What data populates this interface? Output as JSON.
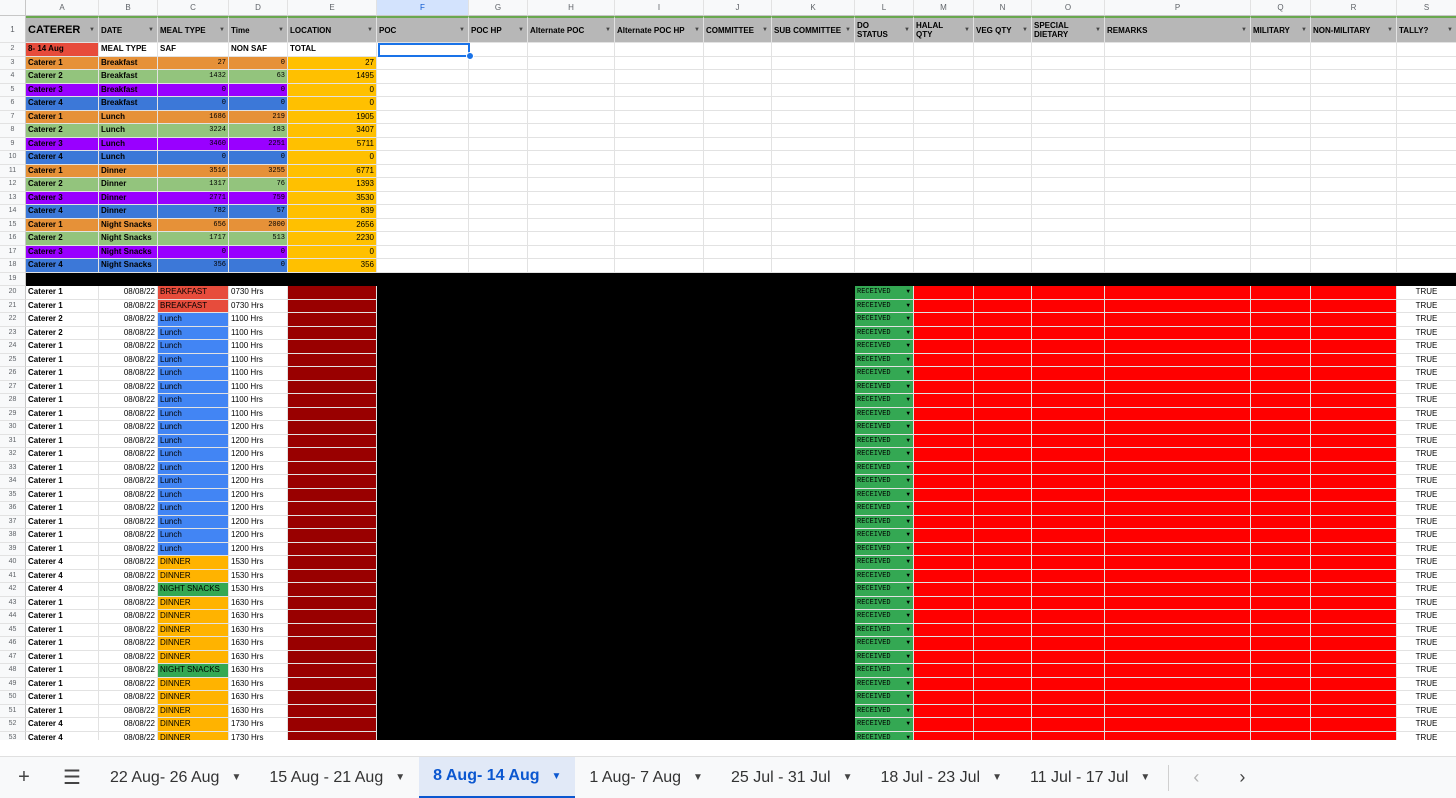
{
  "columns": [
    "A",
    "B",
    "C",
    "D",
    "E",
    "F",
    "G",
    "H",
    "I",
    "J",
    "K",
    "L",
    "M",
    "N",
    "O",
    "P",
    "Q",
    "R",
    "S"
  ],
  "header_row": [
    "CATERER",
    "DATE",
    "MEAL TYPE",
    "Time",
    "LOCATION",
    "POC",
    "POC HP",
    "Alternate POC",
    "Alternate POC HP",
    "COMMITTEE",
    "SUB COMMITTEE",
    "DO STATUS",
    "HALAL QTY",
    "VEG QTY",
    "SPECIAL DIETARY",
    "REMARKS",
    "MILITARY",
    "NON-MILITARY",
    "TALLY?"
  ],
  "summary_header": [
    "8- 14 Aug",
    "MEAL TYPE",
    "SAF",
    "NON SAF",
    "TOTAL"
  ],
  "summary_rows": [
    [
      "Caterer 1",
      "Breakfast",
      "27",
      "0",
      "27"
    ],
    [
      "Caterer 2",
      "Breakfast",
      "1432",
      "63",
      "1495"
    ],
    [
      "Caterer 3",
      "Breakfast",
      "0",
      "0",
      "0"
    ],
    [
      "Caterer 4",
      "Breakfast",
      "0",
      "0",
      "0"
    ],
    [
      "Caterer 1",
      "Lunch",
      "1686",
      "219",
      "1905"
    ],
    [
      "Caterer 2",
      "Lunch",
      "3224",
      "183",
      "3407"
    ],
    [
      "Caterer 3",
      "Lunch",
      "3460",
      "2251",
      "5711"
    ],
    [
      "Caterer 4",
      "Lunch",
      "0",
      "0",
      "0"
    ],
    [
      "Caterer 1",
      "Dinner",
      "3516",
      "3255",
      "6771"
    ],
    [
      "Caterer 2",
      "Dinner",
      "1317",
      "76",
      "1393"
    ],
    [
      "Caterer 3",
      "Dinner",
      "2771",
      "759",
      "3530"
    ],
    [
      "Caterer 4",
      "Dinner",
      "782",
      "57",
      "839"
    ],
    [
      "Caterer 1",
      "Night Snacks",
      "656",
      "2000",
      "2656"
    ],
    [
      "Caterer 2",
      "Night Snacks",
      "1717",
      "513",
      "2230"
    ],
    [
      "Caterer 3",
      "Night Snacks",
      "0",
      "0",
      "0"
    ],
    [
      "Caterer 4",
      "Night Snacks",
      "356",
      "0",
      "356"
    ]
  ],
  "detail_rows": [
    [
      "Caterer 1",
      "08/08/22",
      "BREAKFAST",
      "0730 Hrs",
      "RECEIVED",
      "TRUE"
    ],
    [
      "Caterer 1",
      "08/08/22",
      "BREAKFAST",
      "0730 Hrs",
      "RECEIVED",
      "TRUE"
    ],
    [
      "Caterer 2",
      "08/08/22",
      "Lunch",
      "1100 Hrs",
      "RECEIVED",
      "TRUE"
    ],
    [
      "Caterer 2",
      "08/08/22",
      "Lunch",
      "1100 Hrs",
      "RECEIVED",
      "TRUE"
    ],
    [
      "Caterer 1",
      "08/08/22",
      "Lunch",
      "1100 Hrs",
      "RECEIVED",
      "TRUE"
    ],
    [
      "Caterer 1",
      "08/08/22",
      "Lunch",
      "1100 Hrs",
      "RECEIVED",
      "TRUE"
    ],
    [
      "Caterer 1",
      "08/08/22",
      "Lunch",
      "1100 Hrs",
      "RECEIVED",
      "TRUE"
    ],
    [
      "Caterer 1",
      "08/08/22",
      "Lunch",
      "1100 Hrs",
      "RECEIVED",
      "TRUE"
    ],
    [
      "Caterer 1",
      "08/08/22",
      "Lunch",
      "1100 Hrs",
      "RECEIVED",
      "TRUE"
    ],
    [
      "Caterer 1",
      "08/08/22",
      "Lunch",
      "1100 Hrs",
      "RECEIVED",
      "TRUE"
    ],
    [
      "Caterer 1",
      "08/08/22",
      "Lunch",
      "1200 Hrs",
      "RECEIVED",
      "TRUE"
    ],
    [
      "Caterer 1",
      "08/08/22",
      "Lunch",
      "1200 Hrs",
      "RECEIVED",
      "TRUE"
    ],
    [
      "Caterer 1",
      "08/08/22",
      "Lunch",
      "1200 Hrs",
      "RECEIVED",
      "TRUE"
    ],
    [
      "Caterer 1",
      "08/08/22",
      "Lunch",
      "1200 Hrs",
      "RECEIVED",
      "TRUE"
    ],
    [
      "Caterer 1",
      "08/08/22",
      "Lunch",
      "1200 Hrs",
      "RECEIVED",
      "TRUE"
    ],
    [
      "Caterer 1",
      "08/08/22",
      "Lunch",
      "1200 Hrs",
      "RECEIVED",
      "TRUE"
    ],
    [
      "Caterer 1",
      "08/08/22",
      "Lunch",
      "1200 Hrs",
      "RECEIVED",
      "TRUE"
    ],
    [
      "Caterer 1",
      "08/08/22",
      "Lunch",
      "1200 Hrs",
      "RECEIVED",
      "TRUE"
    ],
    [
      "Caterer 1",
      "08/08/22",
      "Lunch",
      "1200 Hrs",
      "RECEIVED",
      "TRUE"
    ],
    [
      "Caterer 1",
      "08/08/22",
      "Lunch",
      "1200 Hrs",
      "RECEIVED",
      "TRUE"
    ],
    [
      "Caterer 4",
      "08/08/22",
      "DINNER",
      "1530 Hrs",
      "RECEIVED",
      "TRUE"
    ],
    [
      "Caterer 4",
      "08/08/22",
      "DINNER",
      "1530 Hrs",
      "RECEIVED",
      "TRUE"
    ],
    [
      "Caterer 4",
      "08/08/22",
      "NIGHT SNACKS",
      "1530 Hrs",
      "RECEIVED",
      "TRUE"
    ],
    [
      "Caterer 1",
      "08/08/22",
      "DINNER",
      "1630 Hrs",
      "RECEIVED",
      "TRUE"
    ],
    [
      "Caterer 1",
      "08/08/22",
      "DINNER",
      "1630 Hrs",
      "RECEIVED",
      "TRUE"
    ],
    [
      "Caterer 1",
      "08/08/22",
      "DINNER",
      "1630 Hrs",
      "RECEIVED",
      "TRUE"
    ],
    [
      "Caterer 1",
      "08/08/22",
      "DINNER",
      "1630 Hrs",
      "RECEIVED",
      "TRUE"
    ],
    [
      "Caterer 1",
      "08/08/22",
      "DINNER",
      "1630 Hrs",
      "RECEIVED",
      "TRUE"
    ],
    [
      "Caterer 1",
      "08/08/22",
      "NIGHT SNACKS",
      "1630 Hrs",
      "RECEIVED",
      "TRUE"
    ],
    [
      "Caterer 1",
      "08/08/22",
      "DINNER",
      "1630 Hrs",
      "RECEIVED",
      "TRUE"
    ],
    [
      "Caterer 1",
      "08/08/22",
      "DINNER",
      "1630 Hrs",
      "RECEIVED",
      "TRUE"
    ],
    [
      "Caterer 1",
      "08/08/22",
      "DINNER",
      "1630 Hrs",
      "RECEIVED",
      "TRUE"
    ],
    [
      "Caterer 4",
      "08/08/22",
      "DINNER",
      "1730 Hrs",
      "RECEIVED",
      "TRUE"
    ],
    [
      "Caterer 4",
      "08/08/22",
      "DINNER",
      "1730 Hrs",
      "RECEIVED",
      "TRUE"
    ]
  ],
  "tabs": [
    "22 Aug- 26 Aug",
    "15 Aug - 21 Aug",
    "8 Aug- 14 Aug",
    "1 Aug- 7 Aug",
    "25 Jul - 31 Jul",
    "18 Jul - 23 Jul",
    "11 Jul - 17 Jul"
  ],
  "active_tab": "8 Aug- 14 Aug",
  "icons": {
    "add_sheet": "plus-icon",
    "all_sheets": "menu-icon",
    "prev": "chevron-left-icon",
    "next": "chevron-right-icon",
    "tab_menu": "caret-down-icon"
  },
  "colors": {
    "caterer_1": "#e69138",
    "caterer_2": "#93c47d",
    "caterer_3": "#9900ff",
    "caterer_4": "#3c78d8",
    "total": "#ffc000",
    "date_label": "#e74c3c",
    "location_dark": "#990000",
    "received": "#34a853",
    "remarks_red": "#ff0000",
    "breakfast": "#e74c3c",
    "lunch": "#4285f4",
    "dinner": "#ffb300",
    "night_snacks": "#34a853",
    "selection": "#1a73e8"
  }
}
